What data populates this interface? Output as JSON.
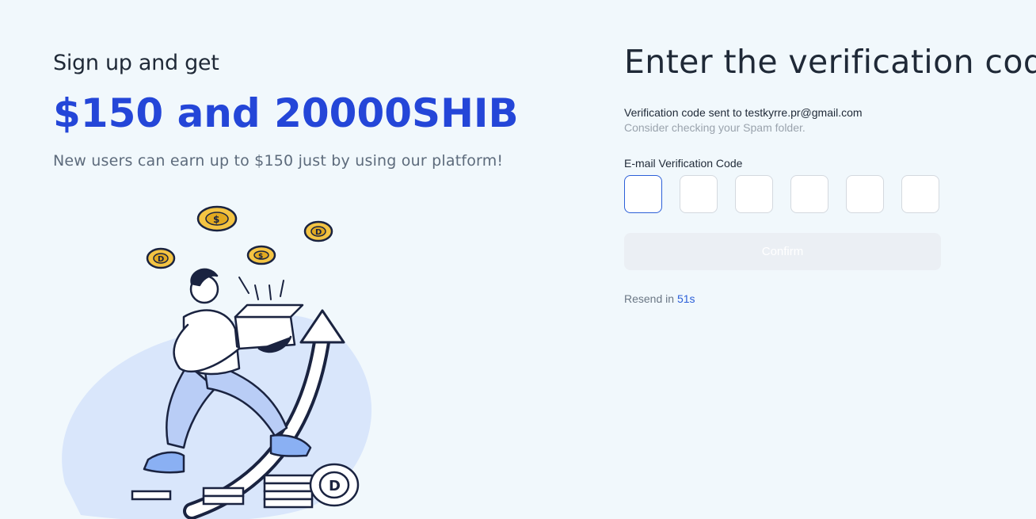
{
  "promo": {
    "intro": "Sign up and get",
    "amount": "$150 and 20000SHIB",
    "description": "New users can earn up to $150 just by using our platform!"
  },
  "illustration": {
    "coin_mark_dollar": "$",
    "coin_mark_d": "D"
  },
  "form": {
    "title": "Enter the verification code",
    "sent_prefix": "Verification code sent to ",
    "email": "testkyrre.pr@gmail.com",
    "spam_hint": "Consider checking your Spam folder.",
    "code_label": "E-mail Verification Code",
    "code_digits": [
      "",
      "",
      "",
      "",
      "",
      ""
    ],
    "confirm_label": "Confirm",
    "resend_prefix": "Resend in ",
    "resend_countdown": "51s"
  },
  "colors": {
    "accent": "#2446d8",
    "link": "#2c5fd8",
    "background": "#f1f8fc"
  }
}
